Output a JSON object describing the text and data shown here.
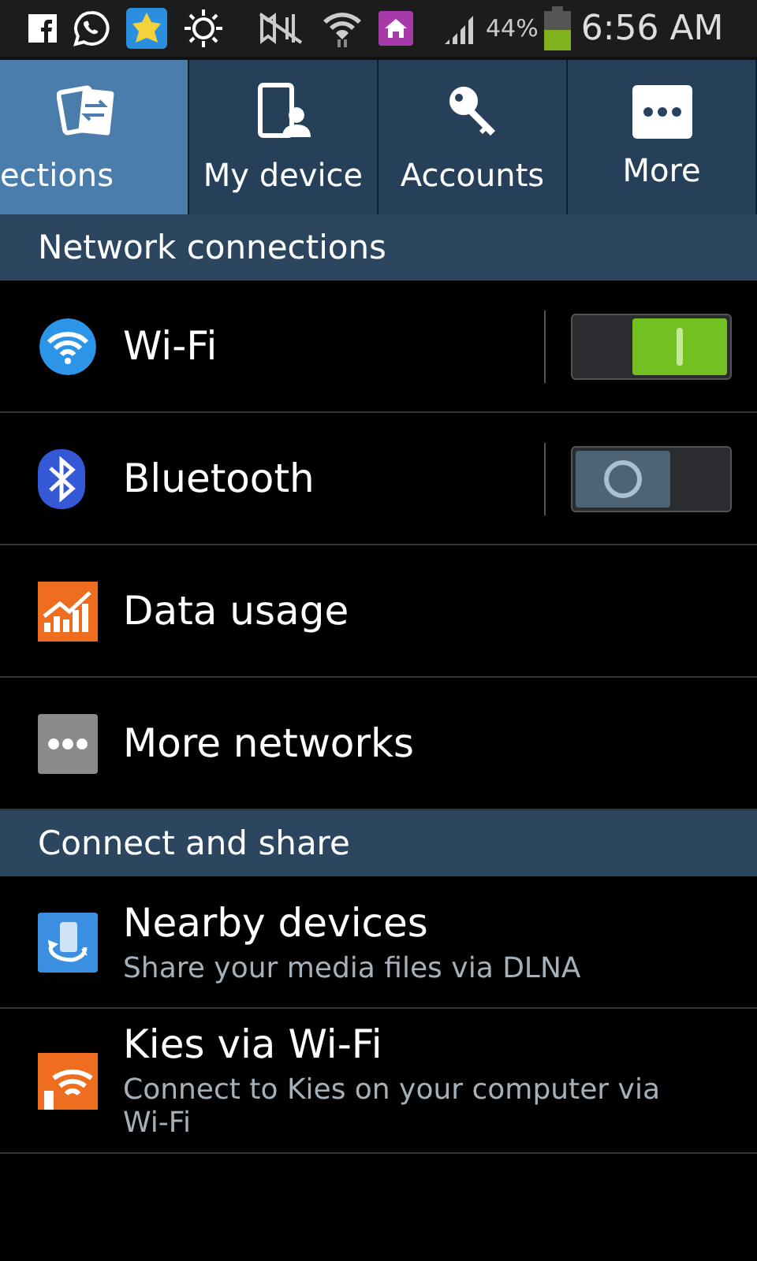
{
  "status_bar": {
    "battery": "44%",
    "time": "6:56 AM"
  },
  "tabs": [
    {
      "label": "ections",
      "selected": true
    },
    {
      "label": "My device",
      "selected": false
    },
    {
      "label": "Accounts",
      "selected": false
    },
    {
      "label": "More",
      "selected": false
    }
  ],
  "sections": [
    {
      "title": "Network connections",
      "items": [
        {
          "kind": "toggle",
          "title": "Wi-Fi",
          "on": true
        },
        {
          "kind": "toggle",
          "title": "Bluetooth",
          "on": false
        },
        {
          "kind": "plain",
          "title": "Data usage"
        },
        {
          "kind": "plain",
          "title": "More networks"
        }
      ]
    },
    {
      "title": "Connect and share",
      "items": [
        {
          "kind": "plain",
          "title": "Nearby devices",
          "subtitle": "Share your media files via DLNA"
        },
        {
          "kind": "plain",
          "title": "Kies via Wi-Fi",
          "subtitle": "Connect to Kies on your computer via Wi-Fi"
        }
      ]
    }
  ]
}
